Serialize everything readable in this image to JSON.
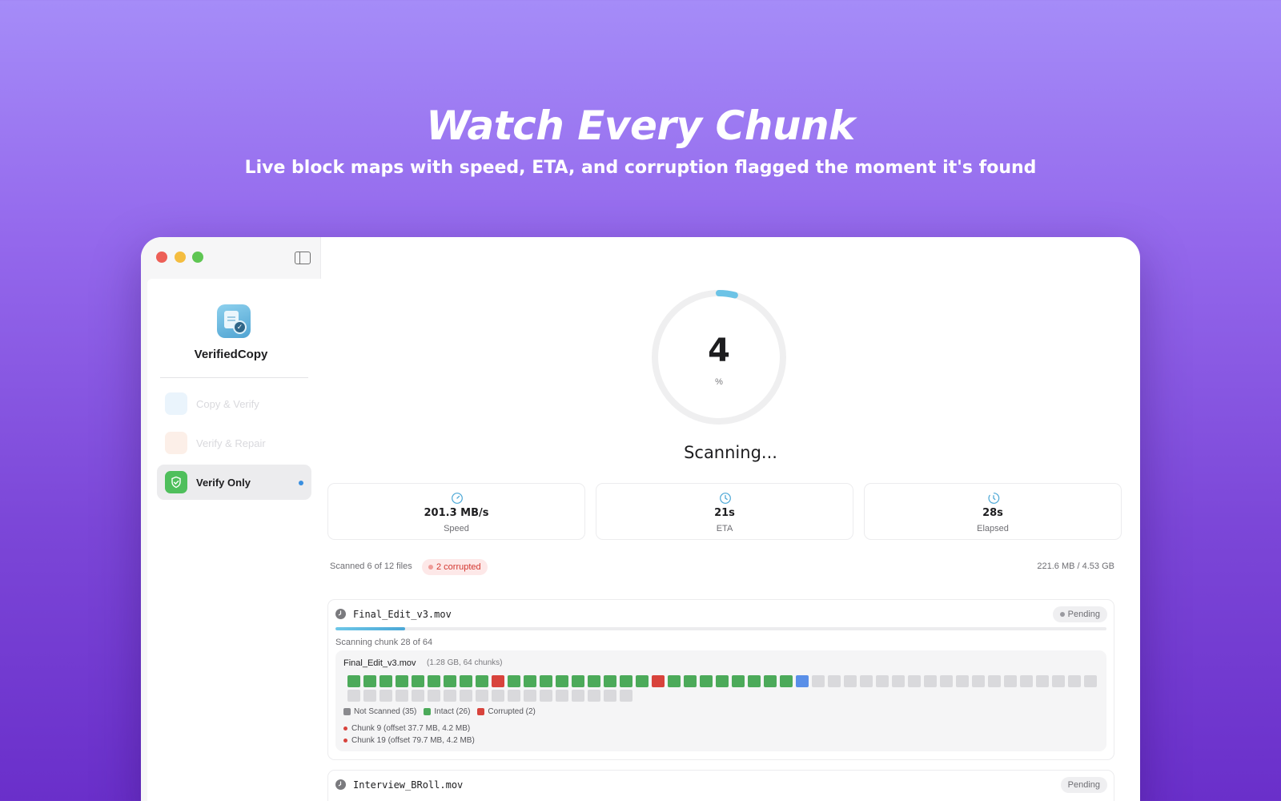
{
  "hero": {
    "title": "Watch Every Chunk",
    "subtitle": "Live block maps with speed, ETA, and corruption flagged the moment it's found"
  },
  "window": {
    "sidebar_toggle_icon": "sidebar-toggle-icon"
  },
  "sidebar": {
    "app_name": "VerifiedCopy",
    "items": [
      {
        "label": "Copy & Verify",
        "icon": "copy-icon",
        "state": "disabled",
        "color": "#d6ecfb"
      },
      {
        "label": "Verify & Repair",
        "icon": "repair-icon",
        "state": "disabled",
        "color": "#fbe2d6"
      },
      {
        "label": "Verify Only",
        "icon": "shield-check-icon",
        "state": "active",
        "color": "#4fbf5c"
      }
    ]
  },
  "progress": {
    "percent": 4,
    "unit": "%",
    "status": "Scanning...",
    "ring_color": "#6cc3e6"
  },
  "stats": [
    {
      "value": "201.3 MB/s",
      "label": "Speed",
      "icon": "gauge-icon"
    },
    {
      "value": "21s",
      "label": "ETA",
      "icon": "clock-icon"
    },
    {
      "value": "28s",
      "label": "Elapsed",
      "icon": "timer-icon"
    }
  ],
  "summary": {
    "scanned": "Scanned 6 of 12 files",
    "corrupted": "2 corrupted",
    "size": "221.6 MB / 4.53 GB"
  },
  "files": [
    {
      "name": "Final_Edit_v3.mov",
      "status": "Pending",
      "progress": 0.09,
      "caption": "Scanning chunk 28 of 64",
      "block_map": {
        "title": "Final_Edit_v3.mov",
        "meta": "(1.28 GB, 64 chunks)",
        "chunks": "IIIIIIIIICIIIIIIIIICIIIIIIIISNNNNNNNNNNNNNNNNNNNNNNNNNNNNNNNNNNNN",
        "legend": {
          "not_scanned": "Not Scanned (35)",
          "intact": "Intact (26)",
          "corrupted": "Corrupted (2)"
        },
        "issues": [
          "Chunk 9 (offset 37.7 MB, 4.2 MB)",
          "Chunk 19 (offset 79.7 MB, 4.2 MB)"
        ]
      }
    },
    {
      "name": "Interview_BRoll.mov",
      "status": "Pending"
    }
  ],
  "colors": {
    "intact": "#4caa5a",
    "corrupted": "#d8433c",
    "not_scanned": "#8a8a8e",
    "scanning": "#5a8fe8",
    "accent": "#6cc3e6"
  }
}
